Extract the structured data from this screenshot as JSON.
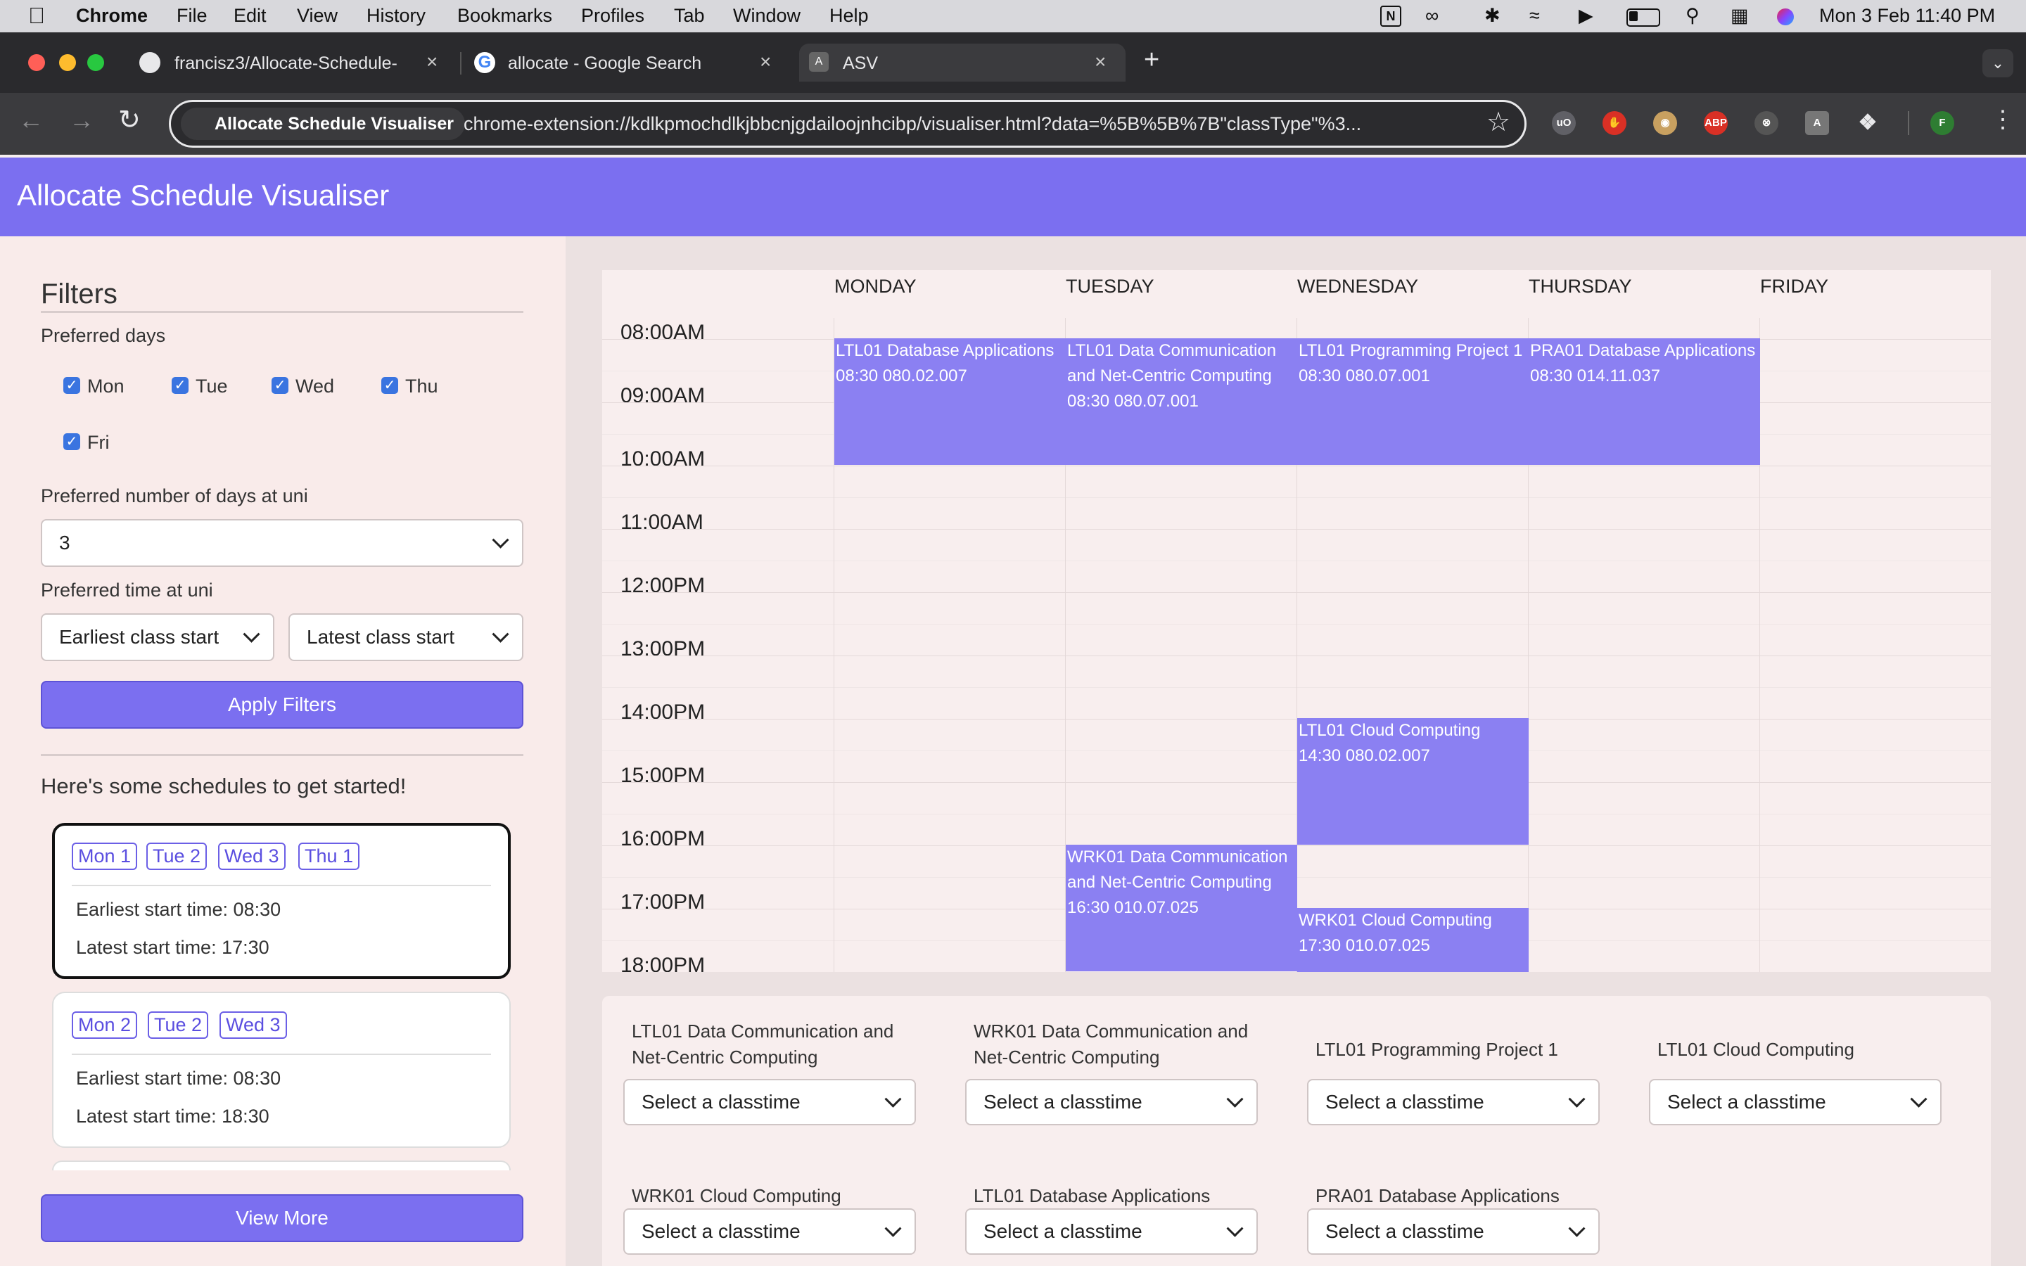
{
  "menubar": {
    "app": "Chrome",
    "items": [
      "File",
      "Edit",
      "View",
      "History",
      "Bookmarks",
      "Profiles",
      "Tab",
      "Window",
      "Help"
    ],
    "clock": "Mon 3 Feb  11:40 PM"
  },
  "tabs": [
    {
      "title": "francisz3/Allocate-Schedule-",
      "icon": "github-icon"
    },
    {
      "title": "allocate - Google Search",
      "icon": "google-icon"
    },
    {
      "title": "ASV",
      "icon": "asv-favicon"
    }
  ],
  "omnibox": {
    "site_chip": "Allocate Schedule Visualiser",
    "url": "chrome-extension://kdlkpmochdlkjbbcnjgdailoojnhcibp/visualiser.html?data=%5B%5B%7B\"classType\"%3..."
  },
  "profile_initial": "F",
  "app": {
    "title": "Allocate Schedule Visualiser"
  },
  "filters": {
    "heading": "Filters",
    "preferred_days_label": "Preferred days",
    "days": [
      "Mon",
      "Tue",
      "Wed",
      "Thu",
      "Fri"
    ],
    "days_count_label": "Preferred number of days at uni",
    "days_count_value": "3",
    "time_label": "Preferred time at uni",
    "earliest_placeholder": "Earliest class start",
    "latest_placeholder": "Latest class start",
    "apply_label": "Apply Filters"
  },
  "schedules": {
    "heading": "Here's some schedules to get started!",
    "cards": [
      {
        "chips": [
          "Mon 1",
          "Tue 2",
          "Wed 3",
          "Thu 1"
        ],
        "earliest": "Earliest start time: 08:30",
        "latest": "Latest start time: 17:30"
      },
      {
        "chips": [
          "Mon 2",
          "Tue 2",
          "Wed 3"
        ],
        "earliest": "Earliest start time: 08:30",
        "latest": "Latest start time: 18:30"
      }
    ],
    "view_more_label": "View More"
  },
  "calendar": {
    "days": [
      "MONDAY",
      "TUESDAY",
      "WEDNESDAY",
      "THURSDAY",
      "FRIDAY"
    ],
    "times": [
      "08:00AM",
      "09:00AM",
      "10:00AM",
      "11:00AM",
      "12:00PM",
      "13:00PM",
      "14:00PM",
      "15:00PM",
      "16:00PM",
      "17:00PM",
      "18:00PM"
    ],
    "events": [
      {
        "day": 0,
        "start": 8.5,
        "end": 10.5,
        "text": "LTL01 Database Applications 08:30 080.02.007"
      },
      {
        "day": 1,
        "start": 8.5,
        "end": 10.5,
        "text": "LTL01 Data Communication and Net-Centric Computing 08:30 080.07.001"
      },
      {
        "day": 2,
        "start": 8.5,
        "end": 10.5,
        "text": "LTL01 Programming Project 1 08:30 080.07.001"
      },
      {
        "day": 3,
        "start": 8.5,
        "end": 10.5,
        "text": "PRA01 Database Applications 08:30 014.11.037"
      },
      {
        "day": 2,
        "start": 14.5,
        "end": 16.5,
        "text": "LTL01 Cloud Computing 14:30 080.02.007"
      },
      {
        "day": 1,
        "start": 16.5,
        "end": 18.5,
        "text": "WRK01 Data Communication and Net-Centric Computing 16:30 010.07.025"
      },
      {
        "day": 2,
        "start": 17.5,
        "end": 19.5,
        "text": "WRK01 Cloud Computing 17:30 010.07.025"
      }
    ]
  },
  "classtimes": {
    "placeholder": "Select a classtime",
    "items": [
      "LTL01 Data Communication and Net-Centric Computing",
      "WRK01 Data Communication and Net-Centric Computing",
      "LTL01 Programming Project 1",
      "LTL01 Cloud Computing",
      "WRK01 Cloud Computing",
      "LTL01 Database Applications",
      "PRA01 Database Applications"
    ]
  }
}
